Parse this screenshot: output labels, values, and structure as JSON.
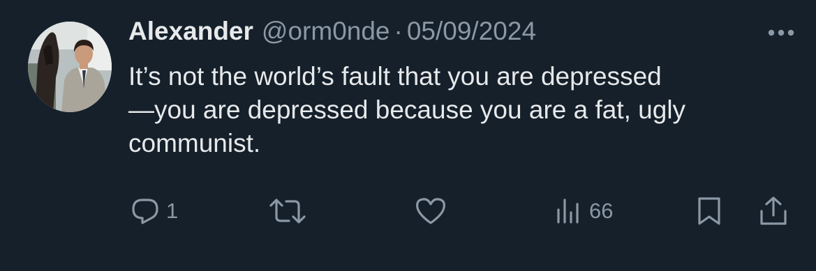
{
  "user": {
    "name": "Alexander",
    "handle": "@orm0nde",
    "separator": "·",
    "date": "05/09/2024"
  },
  "tweet": {
    "lines": [
      "It’s not the world’s fault that you are depressed",
      "—you are depressed because you are a fat, ugly",
      "communist."
    ]
  },
  "actions": {
    "reply_count": "1",
    "views_count": "66"
  },
  "icons": {
    "more": "more-horizontal-icon",
    "reply": "reply-icon",
    "retweet": "retweet-icon",
    "like": "heart-icon",
    "views": "views-chart-icon",
    "bookmark": "bookmark-icon",
    "share": "share-icon"
  },
  "colors": {
    "background": "#15202b",
    "text": "#e7e9ea",
    "secondary": "#8b98a5"
  }
}
